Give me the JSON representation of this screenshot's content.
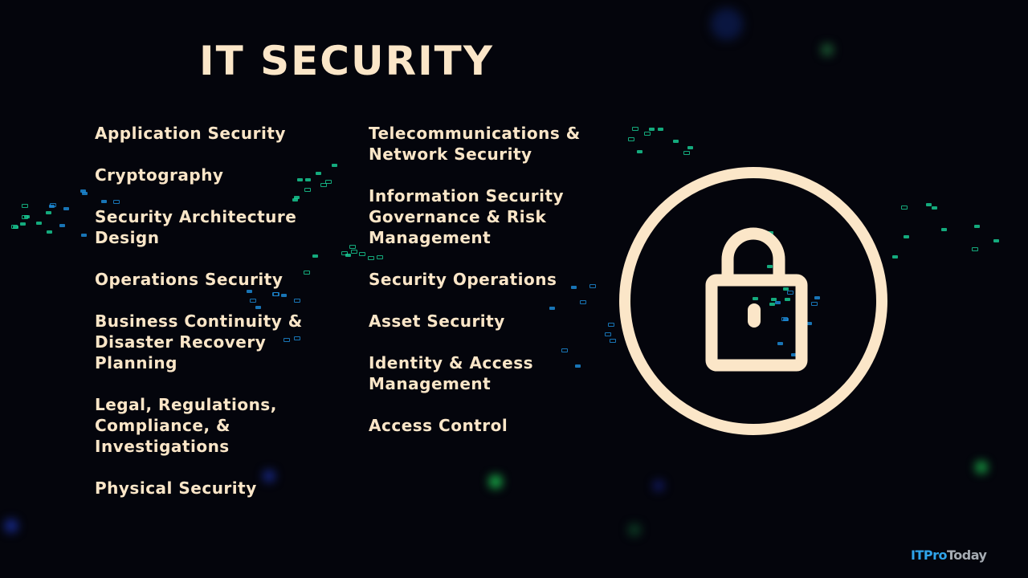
{
  "slide": {
    "title": "IT SECURITY",
    "colors": {
      "text": "#fbe6c8",
      "background": "#04050c",
      "accent_green": "#19d39a",
      "accent_blue": "#1e90e0",
      "logo_blue": "#2fa4ea",
      "logo_gray": "#a6acb3"
    },
    "left_column": [
      {
        "label": "Application Security"
      },
      {
        "label": "Cryptography"
      },
      {
        "label": "Security Architecture\nDesign"
      },
      {
        "label": "Operations Security"
      },
      {
        "label": "Business Continuity &\nDisaster Recovery\nPlanning"
      },
      {
        "label": "Legal, Regulations,\nCompliance, &\nInvestigations"
      },
      {
        "label": "Physical Security"
      }
    ],
    "right_column": [
      {
        "label": "Telecommunications &\nNetwork Security"
      },
      {
        "label": "Information Security\nGovernance & Risk\nManagement"
      },
      {
        "label": "Security Operations"
      },
      {
        "label": "Asset Security"
      },
      {
        "label": "Identity & Access\nManagement"
      },
      {
        "label": "Access Control"
      }
    ],
    "icon": "padlock-in-circle-icon",
    "logo": {
      "part1": "ITPro",
      "part2": "Today"
    }
  }
}
